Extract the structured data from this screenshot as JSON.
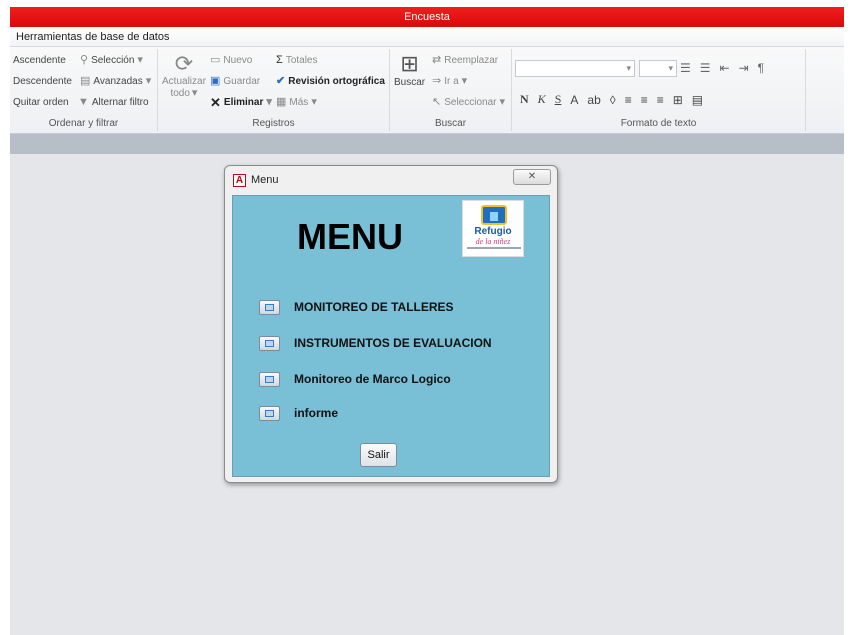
{
  "window": {
    "title": "Encuesta"
  },
  "ribbon": {
    "context_tab": "Herramientas de base de datos",
    "sort_filter": {
      "label": "Ordenar y filtrar",
      "ascending": "Ascendente",
      "descending": "Descendente",
      "clear_sort": "Quitar orden",
      "selection": "Selección",
      "advanced": "Avanzadas",
      "toggle_filter": "Alternar filtro"
    },
    "records": {
      "label": "Registros",
      "refresh_line1": "Actualizar",
      "refresh_line2": "todo",
      "new": "Nuevo",
      "save": "Guardar",
      "delete": "Eliminar",
      "totals": "Totales",
      "spelling": "Revisión ortográfica",
      "more": "Más"
    },
    "find": {
      "label": "Buscar",
      "find_button": "Buscar",
      "replace": "Reemplazar",
      "goto": "Ir a",
      "select": "Seleccionar"
    },
    "text_format": {
      "label": "Formato de texto",
      "bold": "N",
      "italic": "K",
      "underline": "S"
    }
  },
  "dialog": {
    "title": "Menu",
    "close_glyph": "✕",
    "app_icon": "A",
    "form": {
      "heading": "MENU",
      "logo_text": "Refugio",
      "logo_subtext": "de la niñez",
      "items": [
        {
          "label": "MONITOREO DE TALLERES"
        },
        {
          "label": "INSTRUMENTOS DE EVALUACION"
        },
        {
          "label": "Monitoreo de Marco Logico"
        },
        {
          "label": "informe"
        }
      ],
      "exit_button": "Salir"
    }
  },
  "colors": {
    "title_bar": "#e80f0f",
    "form_background": "#79c0d6",
    "workspace": "#e4e6ea"
  }
}
